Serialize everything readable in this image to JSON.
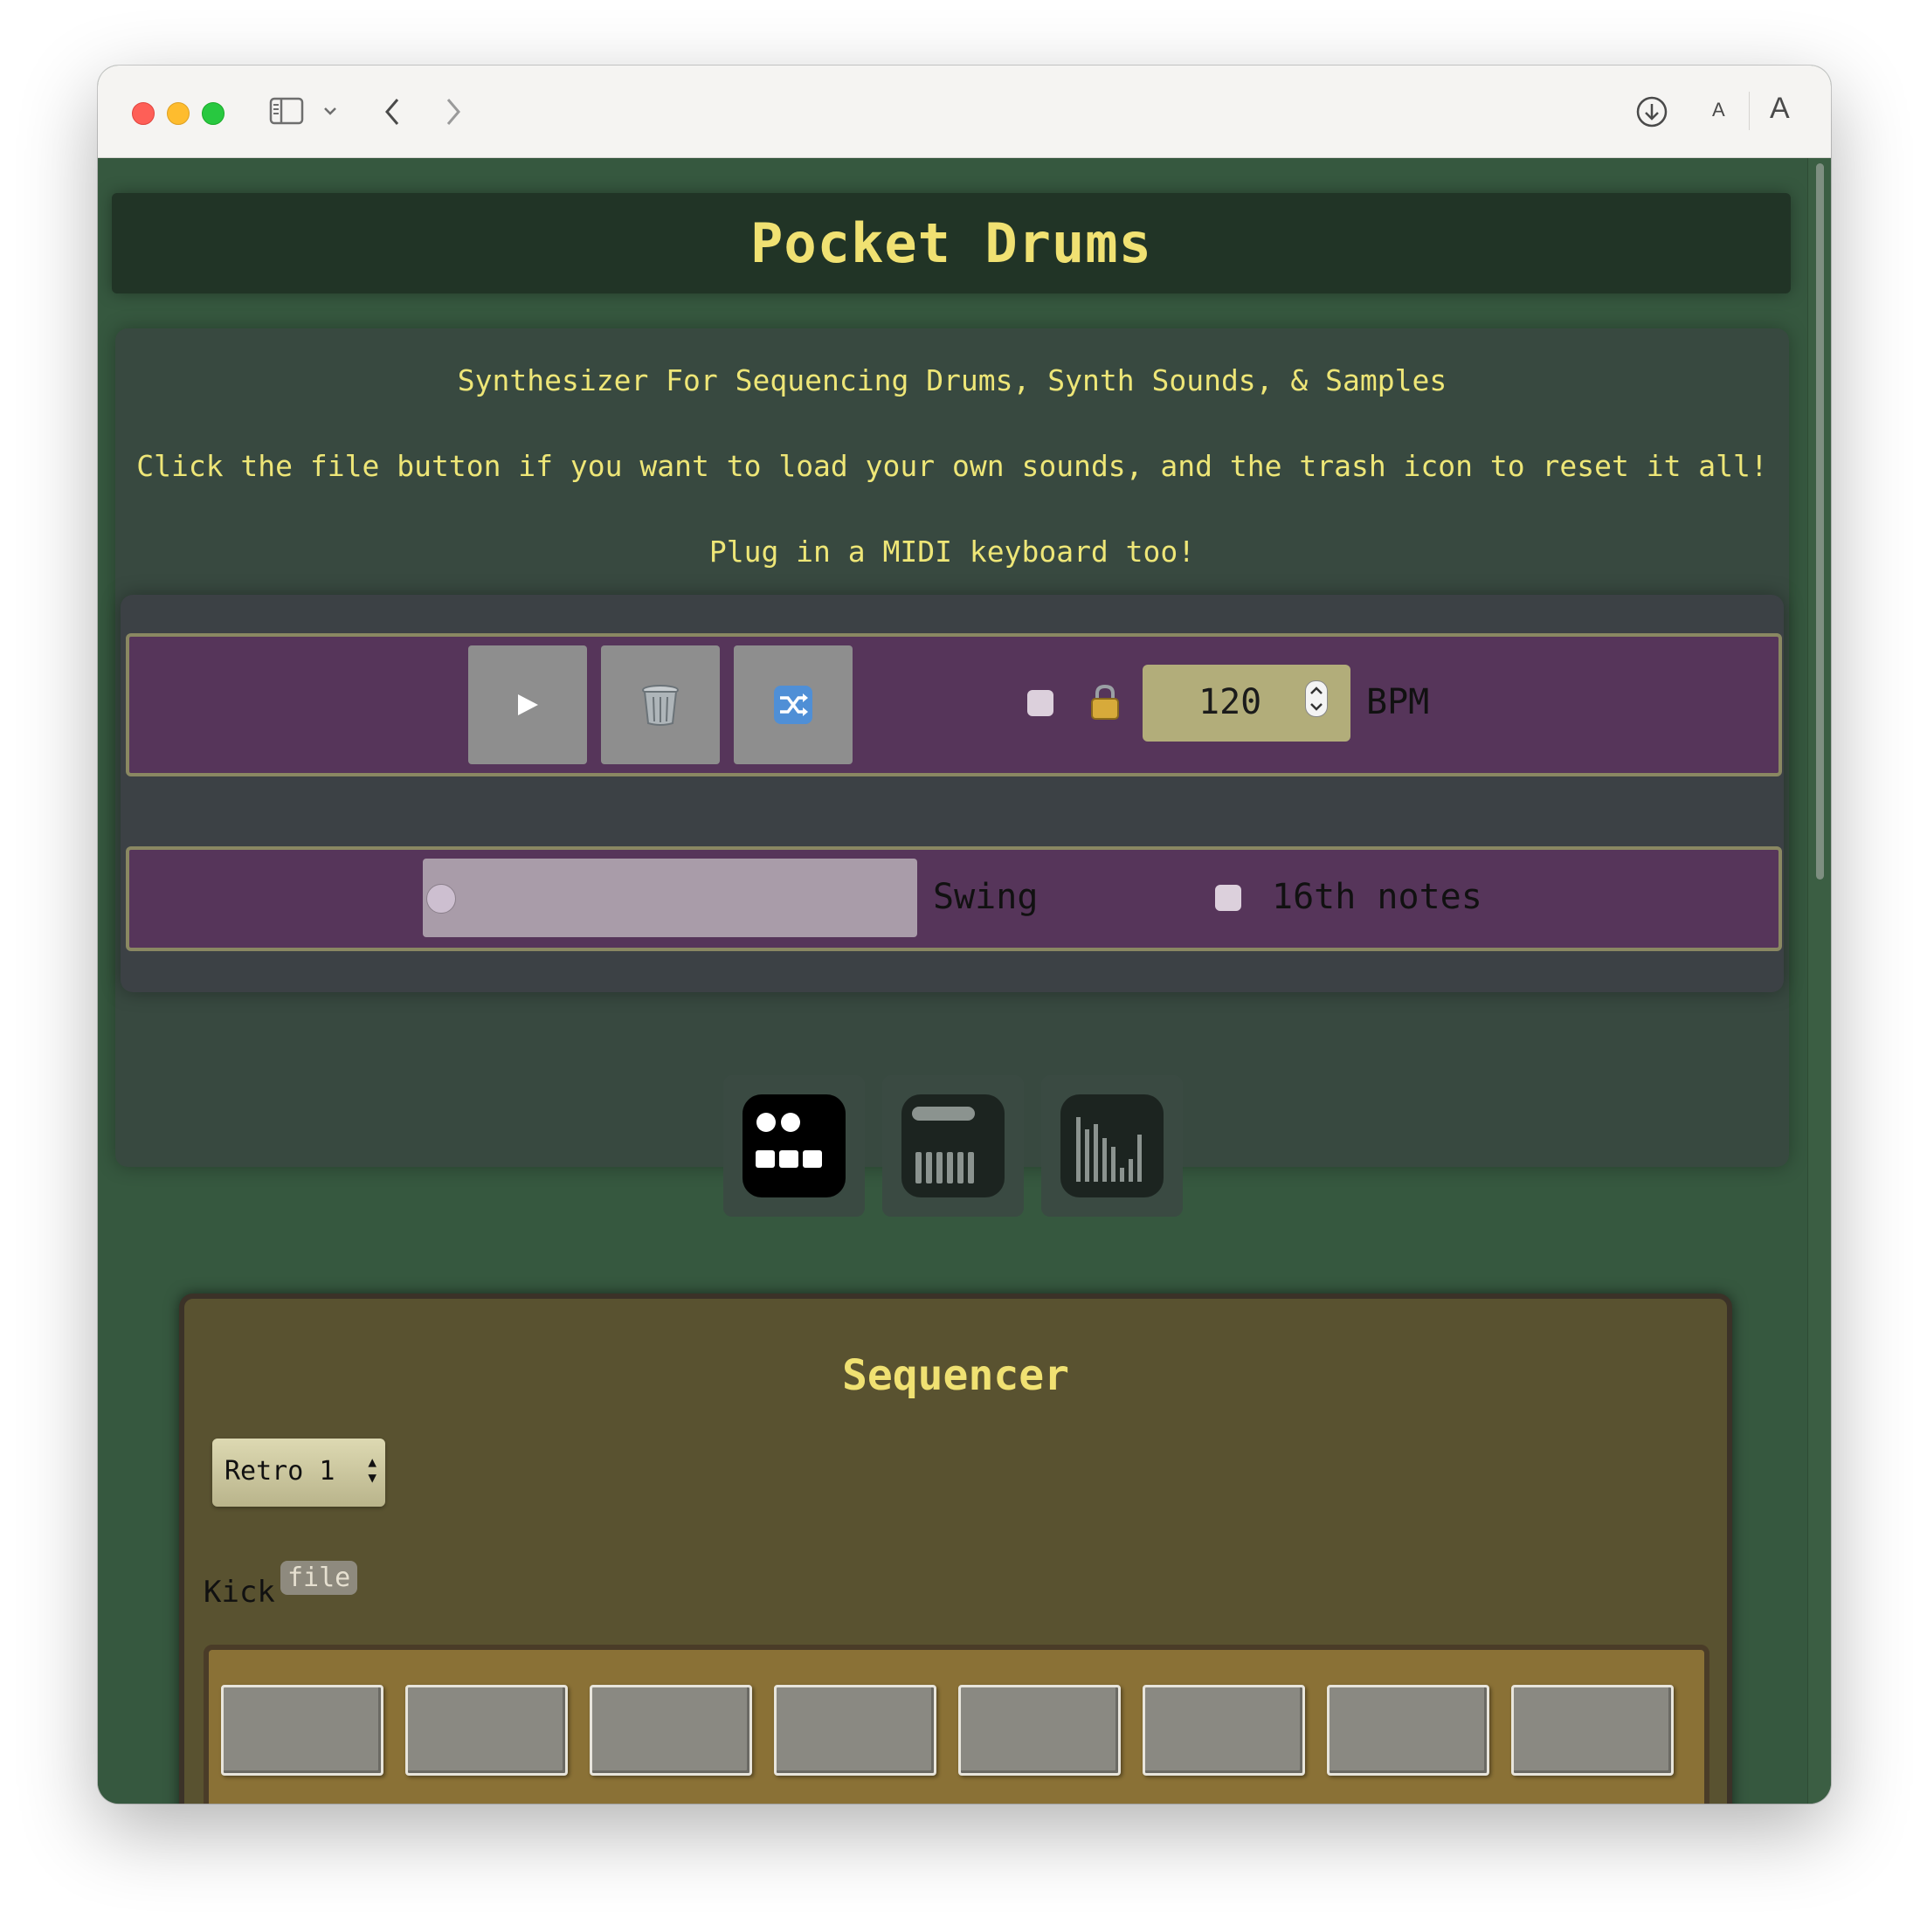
{
  "browser": {
    "window_controls": [
      "close",
      "minimize",
      "zoom"
    ],
    "icons": [
      "sidebar-icon",
      "chevron-down-icon",
      "back-icon",
      "forward-icon",
      "download-icon",
      "text-smaller-icon",
      "text-larger-icon"
    ],
    "text_small_label": "A",
    "text_large_label": "A"
  },
  "app": {
    "title": "Pocket Drums",
    "subtitle": "Synthesizer For Sequencing Drums, Synth Sounds, & Samples",
    "instructions": "Click the file button if you want to load your own sounds, and the trash icon to reset it all!",
    "midi_note": "Plug in a MIDI keyboard too!"
  },
  "transport": {
    "play_icon": "play-icon",
    "trash_icon": "trash-icon",
    "shuffle_icon": "shuffle-icon",
    "lock_icon": "lock-icon",
    "checkbox_checked": false,
    "bpm_value": "120",
    "bpm_label": "BPM"
  },
  "swing": {
    "label": "Swing",
    "value": 0,
    "sixteenth_checked": false,
    "sixteenth_label": "16th notes"
  },
  "modes": [
    {
      "name": "drum-pad-mode-icon",
      "active": true
    },
    {
      "name": "keyboard-mode-icon",
      "active": false
    },
    {
      "name": "sampler-mode-icon",
      "active": false
    }
  ],
  "sequencer": {
    "title": "Sequencer",
    "kit_selected": "Retro 1",
    "track_label": "Kick",
    "file_button": "file",
    "steps": [
      false,
      false,
      false,
      false,
      false,
      false,
      false,
      false
    ]
  },
  "colors": {
    "background": "#36583f",
    "title_text": "#f0e172",
    "info_text": "#eee677",
    "control_bar": "#56355a",
    "sequencer_panel": "#595230",
    "step_track": "#8a7136"
  }
}
